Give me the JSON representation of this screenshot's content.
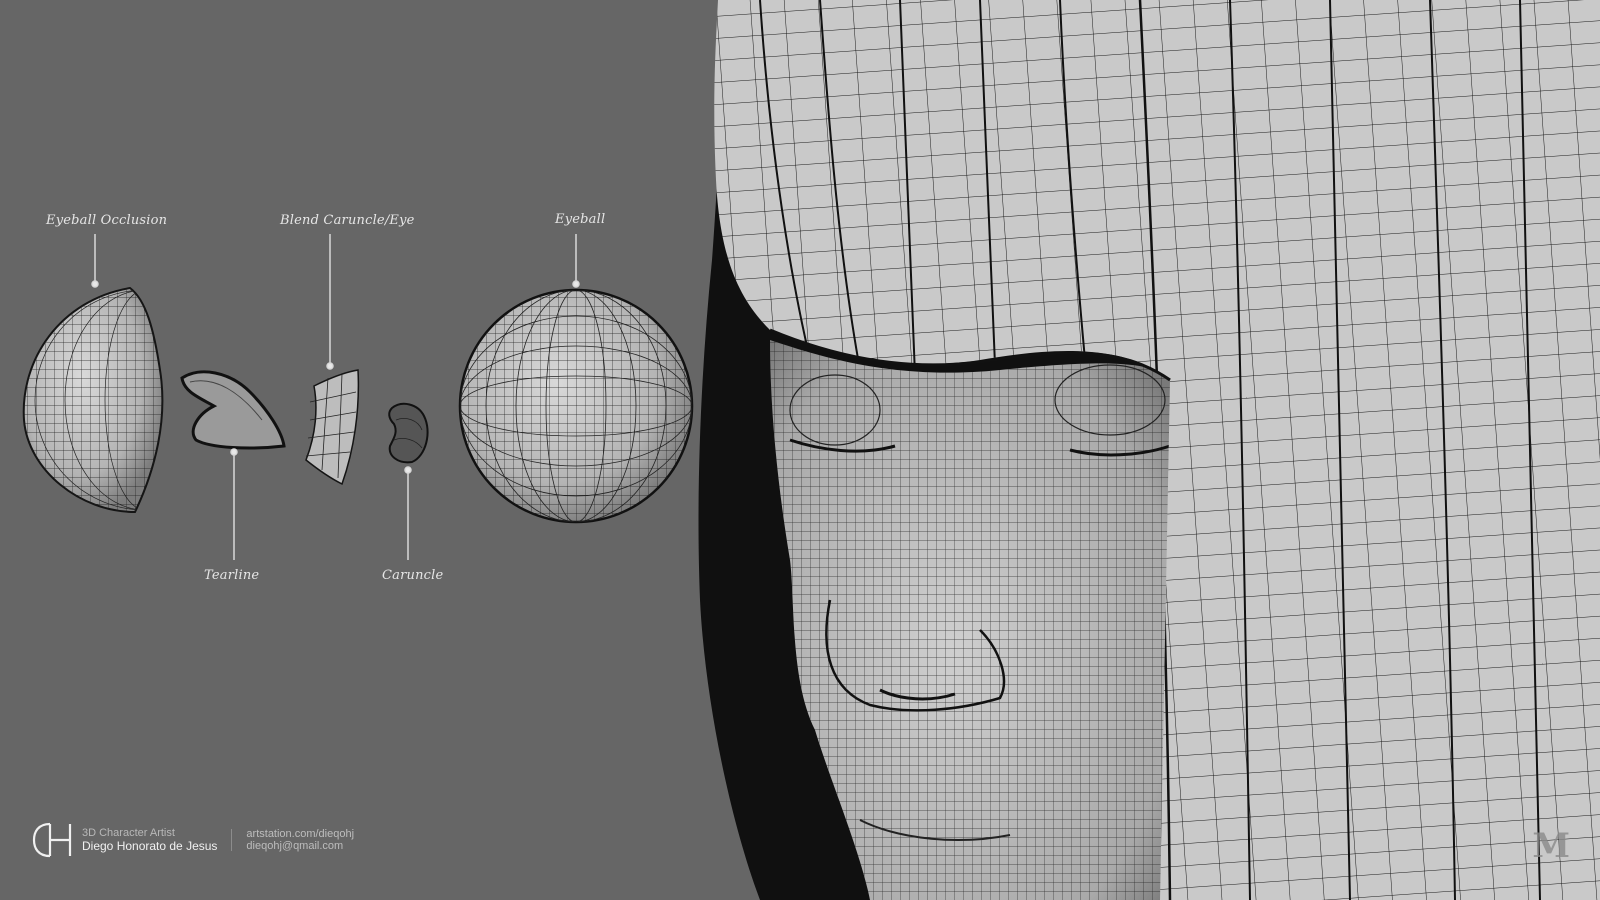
{
  "labels": {
    "eyeball_occlusion": "Eyeball Occlusion",
    "blend_caruncle_eye": "Blend Caruncle/Eye",
    "eyeball": "Eyeball",
    "tearline": "Tearline",
    "caruncle": "Caruncle"
  },
  "footer": {
    "role": "3D Character Artist",
    "name": "Diego Honorato de Jesus",
    "website": "artstation.com/dieqohj",
    "email": "dieqohj@qmail.com"
  },
  "colors": {
    "background": "#666666",
    "render": "#c8c8c8",
    "wire": "#1a1a1a",
    "label": "#e6e6e6"
  },
  "icons": {
    "logo": "dh-monogram-logo",
    "watermark": "m-watermark-icon"
  }
}
